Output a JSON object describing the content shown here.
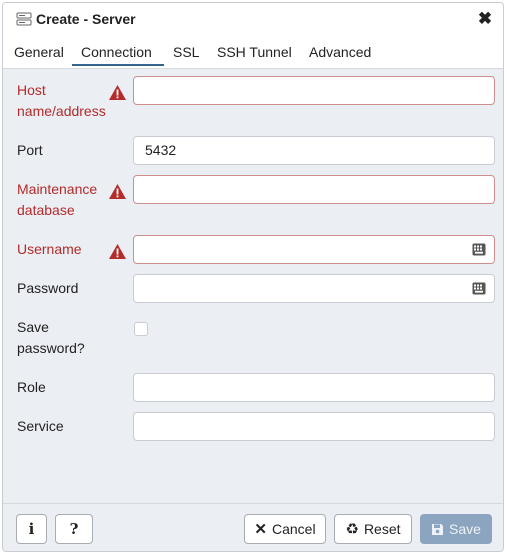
{
  "dialog": {
    "title": "Create - Server",
    "close_glyph": "✖"
  },
  "tabs": [
    {
      "label": "General"
    },
    {
      "label": "Connection"
    },
    {
      "label": "SSL"
    },
    {
      "label": "SSH Tunnel"
    },
    {
      "label": "Advanced"
    }
  ],
  "active_tab": "Connection",
  "fields": {
    "host": {
      "label_line1": "Host",
      "label_line2": "name/address",
      "value": "",
      "error": true
    },
    "port": {
      "label": "Port",
      "value": "5432"
    },
    "maintenance_db": {
      "label_line1": "Maintenance",
      "label_line2": "database",
      "value": "",
      "error": true
    },
    "username": {
      "label": "Username",
      "value": "",
      "error": true
    },
    "password": {
      "label": "Password",
      "value": ""
    },
    "save_password": {
      "label_line1": "Save",
      "label_line2": "password?",
      "checked": false
    },
    "role": {
      "label": "Role",
      "value": ""
    },
    "service": {
      "label": "Service",
      "value": ""
    }
  },
  "footer": {
    "info_label": "i",
    "help_label": "?",
    "cancel_label": "Cancel",
    "reset_label": "Reset",
    "save_label": "Save"
  },
  "colors": {
    "error": "#b32b2b",
    "accent": "#326690",
    "save_disabled": "#8ba4c0"
  },
  "icons": [
    "server-icon",
    "close-icon",
    "warning-icon",
    "keyboard-icon",
    "times-icon",
    "recycle-icon",
    "floppy-icon"
  ]
}
